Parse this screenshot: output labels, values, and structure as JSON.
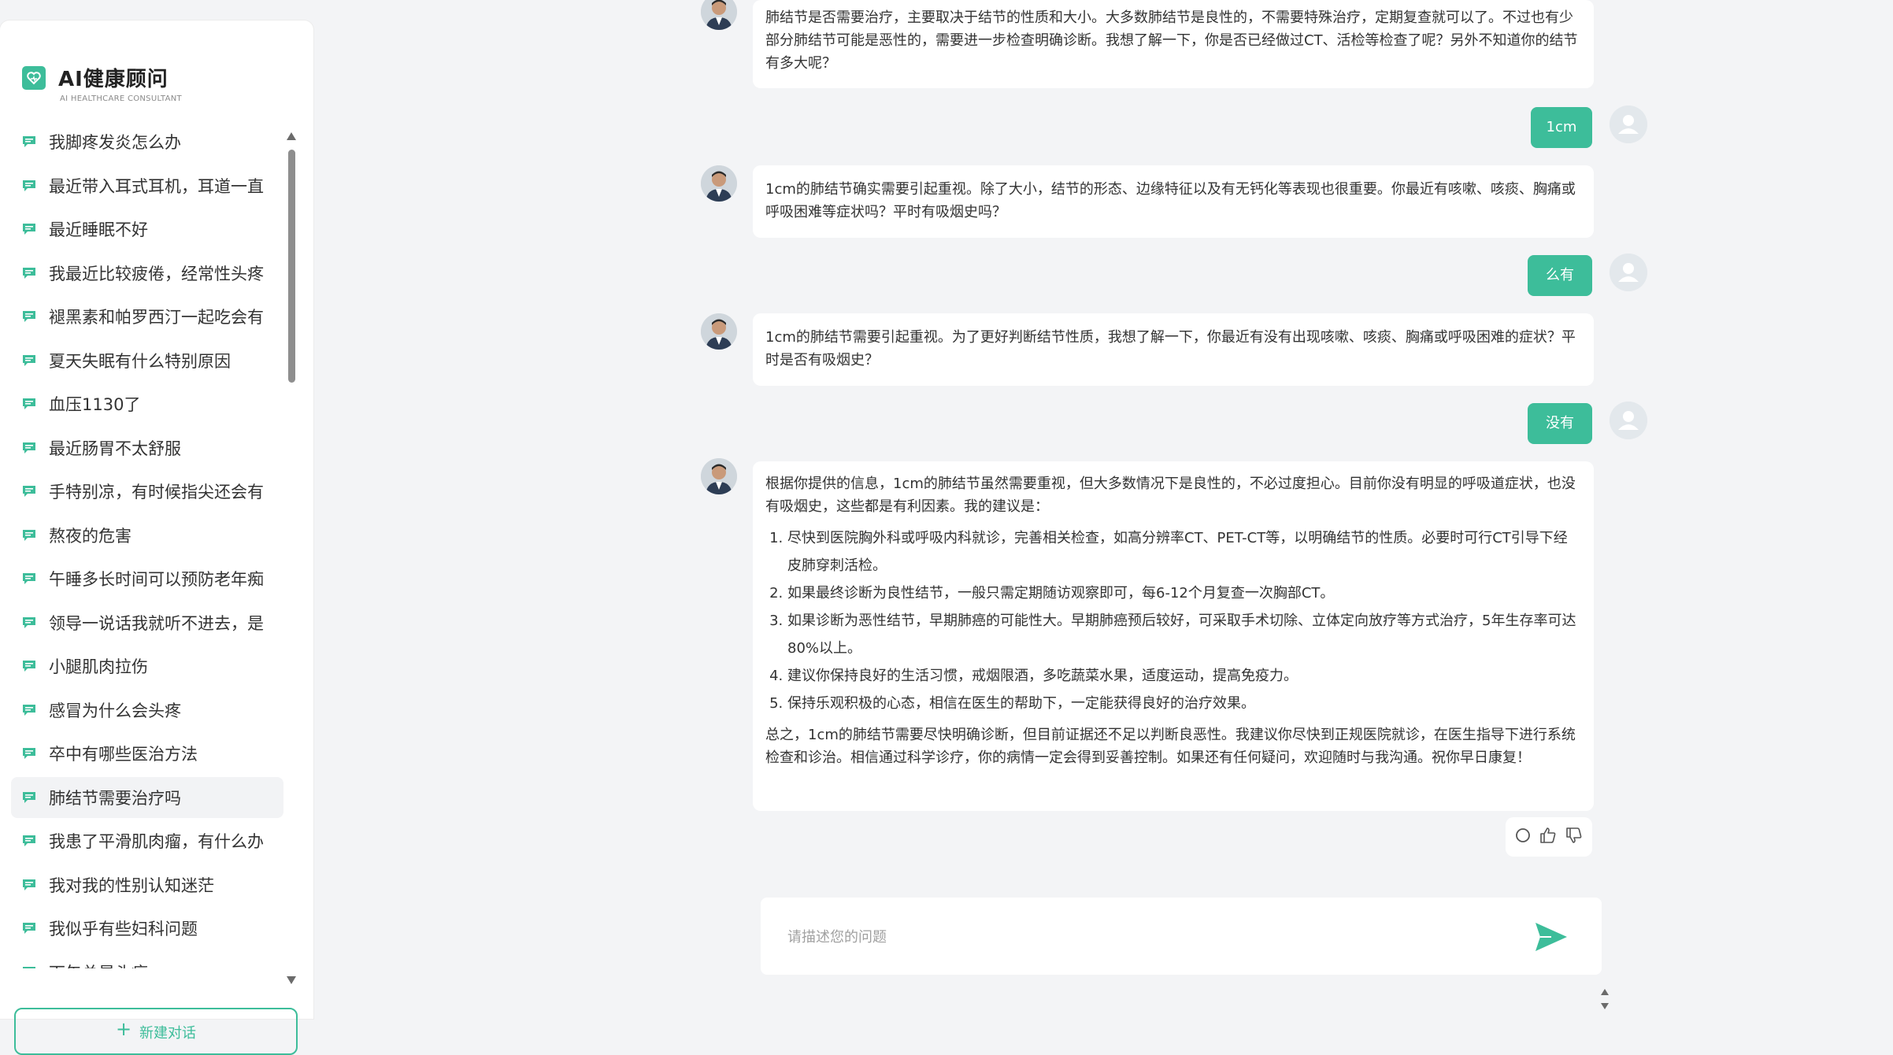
{
  "brand": {
    "title": "AI健康顾问",
    "subtitle": "AI HEALTHCARE CONSULTANT",
    "accent": "#3dbd9a"
  },
  "sidebar": {
    "items": [
      {
        "label": "我脚疼发炎怎么办"
      },
      {
        "label": "最近带入耳式耳机，耳道一直"
      },
      {
        "label": "最近睡眠不好"
      },
      {
        "label": "我最近比较疲倦，经常性头疼"
      },
      {
        "label": "褪黑素和帕罗西汀一起吃会有"
      },
      {
        "label": "夏天失眠有什么特别原因"
      },
      {
        "label": "血压1130了"
      },
      {
        "label": "最近肠胃不太舒服"
      },
      {
        "label": "手特别凉，有时候指尖还会有"
      },
      {
        "label": "熬夜的危害"
      },
      {
        "label": "午睡多长时间可以预防老年痴"
      },
      {
        "label": "领导一说话我就听不进去，是"
      },
      {
        "label": "小腿肌肉拉伤"
      },
      {
        "label": "感冒为什么会头疼"
      },
      {
        "label": "卒中有哪些医治方法"
      },
      {
        "label": "肺结节需要治疗吗",
        "active": true
      },
      {
        "label": "我患了平滑肌肉瘤，有什么办"
      },
      {
        "label": "我对我的性别认知迷茫"
      },
      {
        "label": "我似乎有些妇科问题"
      },
      {
        "label": "下午总是头痛"
      }
    ],
    "new_chat_label": "新建对话",
    "new_chat_icon": "plus-icon"
  },
  "chat": {
    "messages": [
      {
        "role": "ai",
        "text": "肺结节是否需要治疗，主要取决于结节的性质和大小。大多数肺结节是良性的，不需要特殊治疗，定期复查就可以了。不过也有少部分肺结节可能是恶性的，需要进一步检查明确诊断。我想了解一下，你是否已经做过CT、活检等检查了呢？另外不知道你的结节有多大呢？"
      },
      {
        "role": "user",
        "text": "1cm"
      },
      {
        "role": "ai",
        "text": "1cm的肺结节确实需要引起重视。除了大小，结节的形态、边缘特征以及有无钙化等表现也很重要。你最近有咳嗽、咳痰、胸痛或呼吸困难等症状吗？平时有吸烟史吗？"
      },
      {
        "role": "user",
        "text": "么有"
      },
      {
        "role": "ai",
        "text": "1cm的肺结节需要引起重视。为了更好判断结节性质，我想了解一下，你最近有没有出现咳嗽、咳痰、胸痛或呼吸困难的症状？平时是否有吸烟史？"
      },
      {
        "role": "user",
        "text": "没有"
      },
      {
        "role": "ai",
        "intro": "根据你提供的信息，1cm的肺结节虽然需要重视，但大多数情况下是良性的，不必过度担心。目前你没有明显的呼吸道症状，也没有吸烟史，这些都是有利因素。我的建议是：",
        "list": [
          "尽快到医院胸外科或呼吸内科就诊，完善相关检查，如高分辨率CT、PET-CT等，以明确结节的性质。必要时可行CT引导下经皮肺穿刺活检。",
          "如果最终诊断为良性结节，一般只需定期随访观察即可，每6-12个月复查一次胸部CT。",
          "如果诊断为恶性结节，早期肺癌的可能性大。早期肺癌预后较好，可采取手术切除、立体定向放疗等方式治疗，5年生存率可达80%以上。",
          "建议你保持良好的生活习惯，戒烟限酒，多吃蔬菜水果，适度运动，提高免疫力。",
          "保持乐观积极的心态，相信在医生的帮助下，一定能获得良好的治疗效果。"
        ],
        "outro": "总之，1cm的肺结节需要尽快明确诊断，但目前证据还不足以判断良恶性。我建议你尽快到正规医院就诊，在医生指导下进行系统检查和诊治。相信通过科学诊疗，你的病情一定会得到妥善控制。如果还有任何疑问，欢迎随时与我沟通。祝你早日康复！"
      }
    ],
    "feedback_icons": [
      "refresh-icon",
      "thumbs-up-icon",
      "thumbs-down-icon"
    ]
  },
  "composer": {
    "placeholder": "请描述您的问题",
    "send_icon": "send-icon"
  }
}
